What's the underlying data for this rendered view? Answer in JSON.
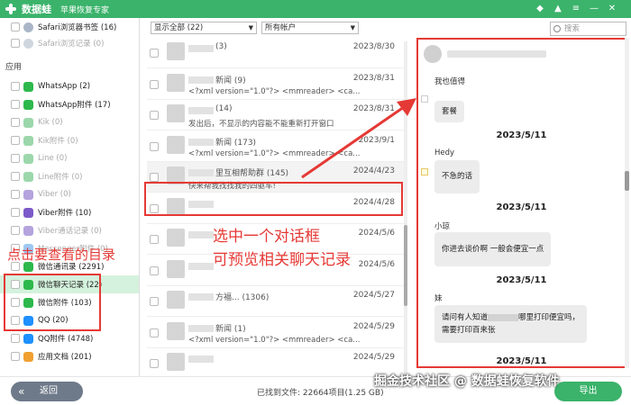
{
  "titlebar": {
    "app_name": "数据蛙",
    "subtitle": "苹果恢复专家"
  },
  "sidebar": {
    "top_items": [
      {
        "label": "Safari浏览器书签 (16)",
        "faded": false
      },
      {
        "label": "Safari浏览记录 (0)",
        "faded": true
      }
    ],
    "section_apps": "应用",
    "apps": [
      {
        "label": "WhatsApp (2)",
        "faded": false,
        "color": "#2db84c"
      },
      {
        "label": "WhatsApp附件 (17)",
        "faded": false,
        "color": "#2db84c"
      },
      {
        "label": "Kik (0)",
        "faded": true,
        "color": "#9cd7ab"
      },
      {
        "label": "Kik附件 (0)",
        "faded": true,
        "color": "#9cd7ab"
      },
      {
        "label": "Line (0)",
        "faded": true,
        "color": "#9cd7ab"
      },
      {
        "label": "Line附件 (0)",
        "faded": true,
        "color": "#9cd7ab"
      },
      {
        "label": "Viber (0)",
        "faded": true,
        "color": "#b4a3dd"
      },
      {
        "label": "Viber附件 (10)",
        "faded": false,
        "color": "#7d5ac9"
      },
      {
        "label": "Viber通话记录 (0)",
        "faded": true,
        "color": "#b4a3dd"
      },
      {
        "label": "Messenger附件 (0)",
        "faded": true,
        "color": "#9ec8f3"
      },
      {
        "label": "微信通讯录 (2291)",
        "faded": false,
        "color": "#2db84c"
      },
      {
        "label": "微信聊天记录 (22)",
        "faded": false,
        "color": "#2db84c",
        "selected": true
      },
      {
        "label": "微信附件 (103)",
        "faded": false,
        "color": "#2db84c"
      },
      {
        "label": "QQ (20)",
        "faded": false,
        "color": "#1e90ff"
      },
      {
        "label": "QQ附件 (4748)",
        "faded": false,
        "color": "#1e90ff"
      },
      {
        "label": "应用文档 (201)",
        "faded": false,
        "color": "#f0a030"
      }
    ]
  },
  "filters": {
    "show_all": "显示全部 (22)",
    "accounts": "所有帐户"
  },
  "search": {
    "placeholder": "搜索"
  },
  "conversations": [
    {
      "title": "(3)",
      "date": "2023/8/30",
      "preview": ""
    },
    {
      "title": "新闻 (9)",
      "date": "2023/8/31",
      "preview": "<?xml version=\"1.0\"?> <mmreader> <ca..."
    },
    {
      "title": "(14)",
      "date": "2023/8/31",
      "preview": "发出后，不显示的内容能不能重新打开窗口"
    },
    {
      "title": "新闻 (173)",
      "date": "2023/9/1",
      "preview": "<?xml version=\"1.0\"?> <mmreader> <ca..."
    },
    {
      "title": "里互相帮助群 (145)",
      "date": "2024/4/23",
      "preview": "快来帮我找找我的四驱车!",
      "highlighted": true
    },
    {
      "title": "",
      "date": "2024/4/28",
      "preview": ""
    },
    {
      "title": "",
      "date": "2024/5/6",
      "preview": ""
    },
    {
      "title": "",
      "date": "2024/5/6",
      "preview": ""
    },
    {
      "title": "方福... (1306)",
      "date": "2024/5/27",
      "preview": ""
    },
    {
      "title": "新闻 (1)",
      "date": "2024/5/29",
      "preview": "<?xml version=\"1.0\"?> <mmreader> <ca..."
    },
    {
      "title": "",
      "date": "2024/5/29",
      "preview": ""
    }
  ],
  "chat": {
    "messages": [
      {
        "sender": "我也值得",
        "text": "套餐",
        "date": "2023/5/11"
      },
      {
        "sender": "Hedy",
        "text": "不急的话",
        "date": "2023/5/11"
      },
      {
        "sender": "小琼",
        "text": "你进去谈价啊 一般会便宜一点",
        "date": "2023/5/11"
      },
      {
        "sender": "妹",
        "text_line1": "请问有人知道",
        "text_line1_tail": "哪里打印便宜吗，",
        "text_line2": "需要打印百来张",
        "date": "2023/5/11"
      }
    ]
  },
  "annotations": {
    "left_text": "点击要查看的目录",
    "mid_line1": "选中一个对话框",
    "mid_line2": "可预览相关聊天记录"
  },
  "bottom": {
    "back_label": "返回",
    "found_text": "已找到文件: 22664项目(1.25 GB)",
    "export_label": "导出",
    "watermark": "掘金技术社区 @ 数据蛙恢复软件"
  },
  "colors": {
    "brand_green": "#3bb36b",
    "annotation_red": "#e53935",
    "selected_row": "#d4f2dd"
  }
}
